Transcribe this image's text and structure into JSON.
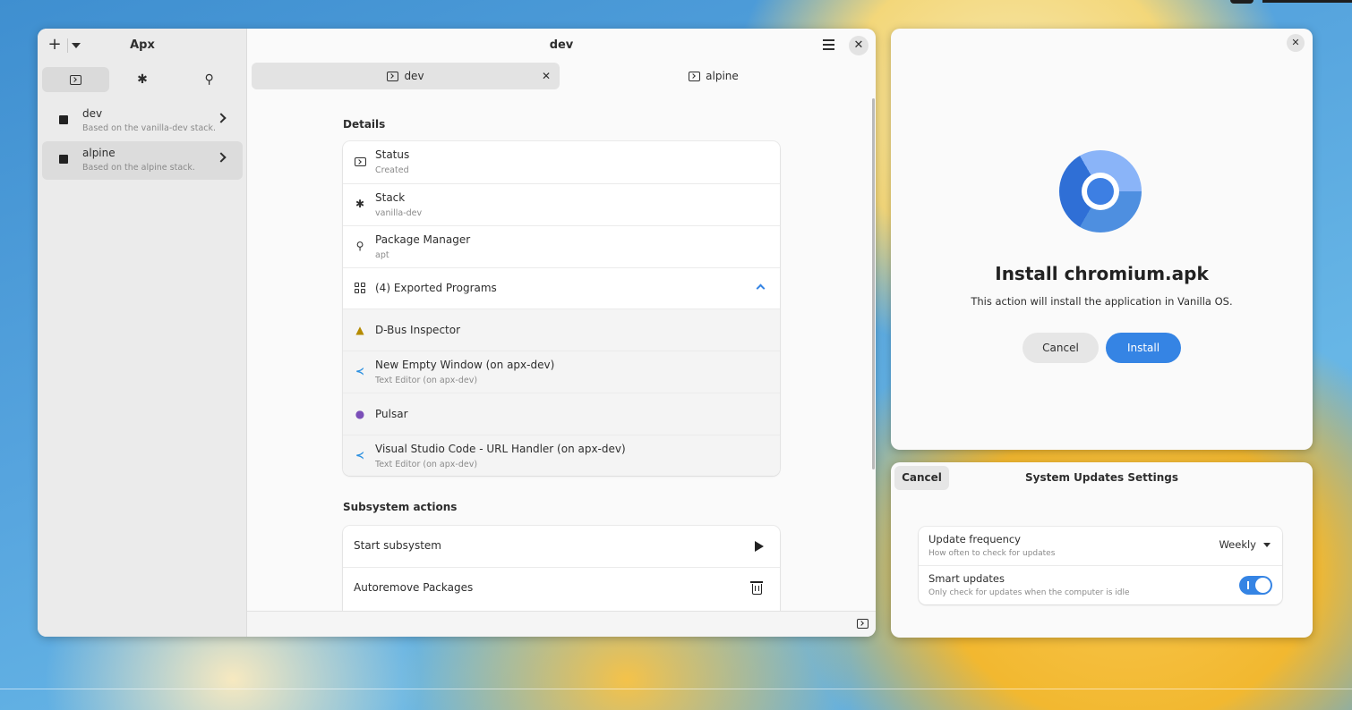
{
  "apx_window": {
    "sidebar": {
      "title": "Apx",
      "add_glyph": "+",
      "tabs": [
        {
          "icon": "terminal-icon",
          "active": true
        },
        {
          "icon": "puzzle-icon",
          "active": false
        },
        {
          "icon": "lightbulb-icon",
          "active": false
        }
      ],
      "items": [
        {
          "name": "dev",
          "subtitle": "Based on the vanilla-dev stack."
        },
        {
          "name": "alpine",
          "subtitle": "Based on the alpine stack."
        }
      ]
    },
    "header": {
      "title": "dev",
      "close_glyph": "✕"
    },
    "tabs": [
      {
        "label": "dev",
        "close_glyph": "✕",
        "active": true
      },
      {
        "label": "alpine",
        "active": false
      }
    ],
    "details": {
      "title": "Details",
      "rows": [
        {
          "title": "Status",
          "subtitle": "Created",
          "icon": "status-icon"
        },
        {
          "title": "Stack",
          "subtitle": "vanilla-dev",
          "icon": "puzzle-icon"
        },
        {
          "title": "Package Manager",
          "subtitle": "apt",
          "icon": "lightbulb-icon"
        }
      ],
      "exported": {
        "title": "(4) Exported Programs",
        "expanded": true,
        "programs": [
          {
            "title": "D-Bus Inspector",
            "subtitle": "",
            "icon": "dbus-inspector-icon"
          },
          {
            "title": "New Empty Window (on apx-dev)",
            "subtitle": "Text Editor (on apx-dev)",
            "icon": "vscode-icon"
          },
          {
            "title": "Pulsar",
            "subtitle": "",
            "icon": "pulsar-icon"
          },
          {
            "title": "Visual Studio Code - URL Handler (on apx-dev)",
            "subtitle": "Text Editor (on apx-dev)",
            "icon": "vscode-icon"
          }
        ]
      }
    },
    "actions": {
      "title": "Subsystem actions",
      "items": [
        {
          "label": "Start subsystem",
          "icon": "play-icon"
        },
        {
          "label": "Autoremove Packages",
          "icon": "trash-icon"
        }
      ]
    }
  },
  "install_dialog": {
    "title": "Install chromium.apk",
    "body": "This action will install the application in Vanilla OS.",
    "cancel_label": "Cancel",
    "install_label": "Install",
    "close_glyph": "✕",
    "accent": "#3584e4"
  },
  "update_settings": {
    "title": "System Updates Settings",
    "cancel_label": "Cancel",
    "frequency": {
      "title": "Update frequency",
      "subtitle": "How often to check for updates",
      "value": "Weekly"
    },
    "smart": {
      "title": "Smart updates",
      "subtitle": "Only check for updates when the computer is idle",
      "enabled": true
    }
  }
}
